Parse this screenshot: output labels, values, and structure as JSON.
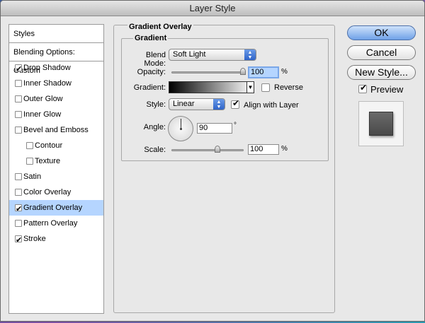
{
  "window": {
    "title": "Layer Style"
  },
  "styles_panel": {
    "header": "Styles",
    "blending": "Blending Options: Custom",
    "items": [
      {
        "label": "Drop Shadow",
        "checked": true,
        "selected": false,
        "indent": false
      },
      {
        "label": "Inner Shadow",
        "checked": false,
        "selected": false,
        "indent": false
      },
      {
        "label": "Outer Glow",
        "checked": false,
        "selected": false,
        "indent": false
      },
      {
        "label": "Inner Glow",
        "checked": false,
        "selected": false,
        "indent": false
      },
      {
        "label": "Bevel and Emboss",
        "checked": false,
        "selected": false,
        "indent": false
      },
      {
        "label": "Contour",
        "checked": false,
        "selected": false,
        "indent": true
      },
      {
        "label": "Texture",
        "checked": false,
        "selected": false,
        "indent": true
      },
      {
        "label": "Satin",
        "checked": false,
        "selected": false,
        "indent": false
      },
      {
        "label": "Color Overlay",
        "checked": false,
        "selected": false,
        "indent": false
      },
      {
        "label": "Gradient Overlay",
        "checked": true,
        "selected": true,
        "indent": false
      },
      {
        "label": "Pattern Overlay",
        "checked": false,
        "selected": false,
        "indent": false
      },
      {
        "label": "Stroke",
        "checked": true,
        "selected": false,
        "indent": false
      }
    ]
  },
  "gradient_overlay": {
    "title": "Gradient Overlay",
    "section": "Gradient",
    "blend_mode_label": "Blend Mode:",
    "blend_mode_value": "Soft Light",
    "opacity_label": "Opacity:",
    "opacity_value": "100",
    "opacity_unit": "%",
    "opacity_fraction": 1.0,
    "gradient_label": "Gradient:",
    "reverse_label": "Reverse",
    "reverse_checked": false,
    "style_label": "Style:",
    "style_value": "Linear",
    "align_label": "Align with Layer",
    "align_checked": true,
    "angle_label": "Angle:",
    "angle_value": "90",
    "angle_unit": "°",
    "scale_label": "Scale:",
    "scale_value": "100",
    "scale_unit": "%",
    "scale_fraction": 0.65
  },
  "buttons": {
    "ok": "OK",
    "cancel": "Cancel",
    "new_style": "New Style...",
    "preview_label": "Preview",
    "preview_checked": true
  },
  "colors": {
    "selected_row": "#b5d5ff",
    "default_button": "#6fa1e8"
  },
  "icons": {
    "dropdown": "chevron-updown-icon",
    "check": "check-icon"
  }
}
